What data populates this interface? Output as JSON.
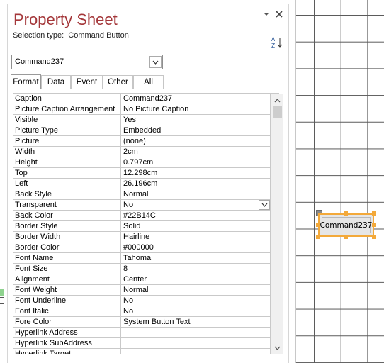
{
  "pane": {
    "title": "Property Sheet",
    "selection_type_label": "Selection type:",
    "selection_type_value": "Command Button",
    "selected_object": "Command237"
  },
  "tabs": [
    {
      "label": "Format",
      "active": true
    },
    {
      "label": "Data",
      "active": false
    },
    {
      "label": "Event",
      "active": false
    },
    {
      "label": "Other",
      "active": false
    },
    {
      "label": "All",
      "active": false
    }
  ],
  "properties": [
    {
      "name": "Caption",
      "value": "Command237"
    },
    {
      "name": "Picture Caption Arrangement",
      "value": "No Picture Caption"
    },
    {
      "name": "Visible",
      "value": "Yes"
    },
    {
      "name": "Picture Type",
      "value": "Embedded"
    },
    {
      "name": "Picture",
      "value": "(none)"
    },
    {
      "name": "Width",
      "value": "2cm"
    },
    {
      "name": "Height",
      "value": "0.797cm"
    },
    {
      "name": "Top",
      "value": "12.298cm"
    },
    {
      "name": "Left",
      "value": "26.196cm"
    },
    {
      "name": "Back Style",
      "value": "Normal"
    },
    {
      "name": "Transparent",
      "value": "No",
      "dropdown": true
    },
    {
      "name": "Back Color",
      "value": "#22B14C"
    },
    {
      "name": "Border Style",
      "value": "Solid"
    },
    {
      "name": "Border Width",
      "value": "Hairline"
    },
    {
      "name": "Border Color",
      "value": "#000000"
    },
    {
      "name": "Font Name",
      "value": "Tahoma"
    },
    {
      "name": "Font Size",
      "value": "8"
    },
    {
      "name": "Alignment",
      "value": "Center"
    },
    {
      "name": "Font Weight",
      "value": "Normal"
    },
    {
      "name": "Font Underline",
      "value": "No"
    },
    {
      "name": "Font Italic",
      "value": "No"
    },
    {
      "name": "Fore Color",
      "value": "System Button Text"
    },
    {
      "name": "Hyperlink Address",
      "value": ""
    },
    {
      "name": "Hyperlink SubAddress",
      "value": ""
    },
    {
      "name": "Hyperlink Target",
      "value": ""
    }
  ],
  "design": {
    "button_caption": "Command237"
  },
  "icons": {
    "dropdown": "chevron-down-icon",
    "close": "close-icon",
    "sort": "sort-az-icon",
    "scroll_up": "scroll-up-icon",
    "scroll_down": "scroll-down-icon"
  },
  "colors": {
    "title": "#a4373a",
    "selection_border": "#f3a93a",
    "grid_line": "#5a5a5a"
  }
}
